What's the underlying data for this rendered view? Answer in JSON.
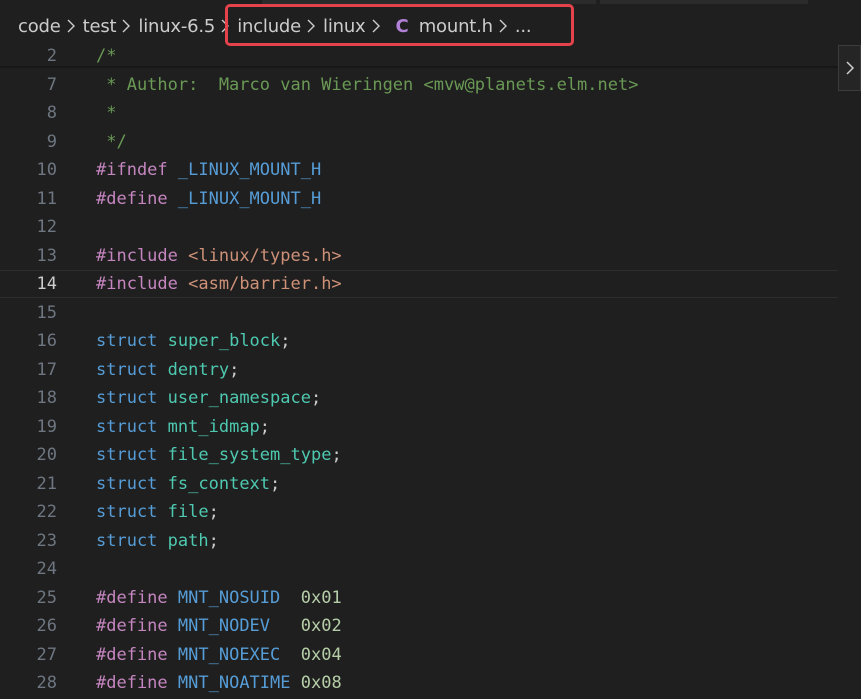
{
  "breadcrumb": {
    "items": [
      "code",
      "test",
      "linux-6.5",
      "include",
      "linux"
    ],
    "file_icon": "C",
    "file_name": "mount.h",
    "overflow": "..."
  },
  "editor": {
    "active_line": "14",
    "lines": [
      {
        "num": "2",
        "tokens": [
          {
            "c": "comment",
            "t": "/*"
          }
        ]
      },
      {
        "num": "7",
        "tokens": [
          {
            "c": "comment",
            "t": " * Author:  Marco van Wieringen <mvw@planets.elm.net>"
          }
        ]
      },
      {
        "num": "8",
        "tokens": [
          {
            "c": "comment",
            "t": " *"
          }
        ]
      },
      {
        "num": "9",
        "tokens": [
          {
            "c": "comment",
            "t": " */"
          }
        ]
      },
      {
        "num": "10",
        "tokens": [
          {
            "c": "pre",
            "t": "#ifndef"
          },
          {
            "c": "plain",
            "t": " "
          },
          {
            "c": "macro",
            "t": "_LINUX_MOUNT_H"
          }
        ]
      },
      {
        "num": "11",
        "tokens": [
          {
            "c": "pre",
            "t": "#define"
          },
          {
            "c": "plain",
            "t": " "
          },
          {
            "c": "macro",
            "t": "_LINUX_MOUNT_H"
          }
        ]
      },
      {
        "num": "12",
        "tokens": []
      },
      {
        "num": "13",
        "tokens": [
          {
            "c": "pre",
            "t": "#include"
          },
          {
            "c": "plain",
            "t": " "
          },
          {
            "c": "str",
            "t": "<linux/types.h>"
          }
        ]
      },
      {
        "num": "14",
        "tokens": [
          {
            "c": "pre",
            "t": "#include"
          },
          {
            "c": "plain",
            "t": " "
          },
          {
            "c": "str",
            "t": "<asm/barrier.h>"
          }
        ]
      },
      {
        "num": "15",
        "tokens": []
      },
      {
        "num": "16",
        "tokens": [
          {
            "c": "kw",
            "t": "struct"
          },
          {
            "c": "plain",
            "t": " "
          },
          {
            "c": "type",
            "t": "super_block"
          },
          {
            "c": "plain",
            "t": ";"
          }
        ]
      },
      {
        "num": "17",
        "tokens": [
          {
            "c": "kw",
            "t": "struct"
          },
          {
            "c": "plain",
            "t": " "
          },
          {
            "c": "type",
            "t": "dentry"
          },
          {
            "c": "plain",
            "t": ";"
          }
        ]
      },
      {
        "num": "18",
        "tokens": [
          {
            "c": "kw",
            "t": "struct"
          },
          {
            "c": "plain",
            "t": " "
          },
          {
            "c": "type",
            "t": "user_namespace"
          },
          {
            "c": "plain",
            "t": ";"
          }
        ]
      },
      {
        "num": "19",
        "tokens": [
          {
            "c": "kw",
            "t": "struct"
          },
          {
            "c": "plain",
            "t": " "
          },
          {
            "c": "type",
            "t": "mnt_idmap"
          },
          {
            "c": "plain",
            "t": ";"
          }
        ]
      },
      {
        "num": "20",
        "tokens": [
          {
            "c": "kw",
            "t": "struct"
          },
          {
            "c": "plain",
            "t": " "
          },
          {
            "c": "type",
            "t": "file_system_type"
          },
          {
            "c": "plain",
            "t": ";"
          }
        ]
      },
      {
        "num": "21",
        "tokens": [
          {
            "c": "kw",
            "t": "struct"
          },
          {
            "c": "plain",
            "t": " "
          },
          {
            "c": "type",
            "t": "fs_context"
          },
          {
            "c": "plain",
            "t": ";"
          }
        ]
      },
      {
        "num": "22",
        "tokens": [
          {
            "c": "kw",
            "t": "struct"
          },
          {
            "c": "plain",
            "t": " "
          },
          {
            "c": "type",
            "t": "file"
          },
          {
            "c": "plain",
            "t": ";"
          }
        ]
      },
      {
        "num": "23",
        "tokens": [
          {
            "c": "kw",
            "t": "struct"
          },
          {
            "c": "plain",
            "t": " "
          },
          {
            "c": "type",
            "t": "path"
          },
          {
            "c": "plain",
            "t": ";"
          }
        ]
      },
      {
        "num": "24",
        "tokens": []
      },
      {
        "num": "25",
        "tokens": [
          {
            "c": "pre",
            "t": "#define"
          },
          {
            "c": "plain",
            "t": " "
          },
          {
            "c": "macro",
            "t": "MNT_NOSUID"
          },
          {
            "c": "plain",
            "t": "  "
          },
          {
            "c": "num",
            "t": "0x01"
          }
        ]
      },
      {
        "num": "26",
        "tokens": [
          {
            "c": "pre",
            "t": "#define"
          },
          {
            "c": "plain",
            "t": " "
          },
          {
            "c": "macro",
            "t": "MNT_NODEV"
          },
          {
            "c": "plain",
            "t": "   "
          },
          {
            "c": "num",
            "t": "0x02"
          }
        ]
      },
      {
        "num": "27",
        "tokens": [
          {
            "c": "pre",
            "t": "#define"
          },
          {
            "c": "plain",
            "t": " "
          },
          {
            "c": "macro",
            "t": "MNT_NOEXEC"
          },
          {
            "c": "plain",
            "t": "  "
          },
          {
            "c": "num",
            "t": "0x04"
          }
        ]
      },
      {
        "num": "28",
        "tokens": [
          {
            "c": "pre",
            "t": "#define"
          },
          {
            "c": "plain",
            "t": " "
          },
          {
            "c": "macro",
            "t": "MNT_NOATIME"
          },
          {
            "c": "plain",
            "t": " "
          },
          {
            "c": "num",
            "t": "0x08"
          }
        ]
      }
    ]
  },
  "colors": {
    "background": "#1f1f1f",
    "highlight_box": "#e5434b",
    "c_file_icon": "#b180d7"
  }
}
